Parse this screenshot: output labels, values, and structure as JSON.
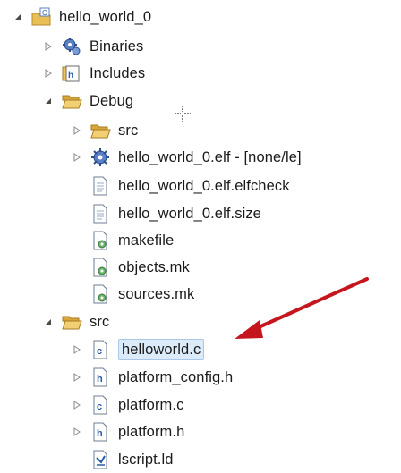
{
  "tree": {
    "items": [
      {
        "label": "hello_world_0",
        "icon": "c-project-icon",
        "twisty": "expanded"
      },
      {
        "label": "Binaries",
        "icon": "binaries-icon",
        "twisty": "collapsed"
      },
      {
        "label": "Includes",
        "icon": "includes-icon",
        "twisty": "collapsed"
      },
      {
        "label": "Debug",
        "icon": "folder-open-icon",
        "twisty": "expanded"
      },
      {
        "label": "src",
        "icon": "folder-open-icon",
        "twisty": "collapsed"
      },
      {
        "label": "hello_world_0.elf - [none/le]",
        "icon": "elf-binary-icon",
        "twisty": "collapsed"
      },
      {
        "label": "hello_world_0.elf.elfcheck",
        "icon": "text-file-icon",
        "twisty": "none"
      },
      {
        "label": "hello_world_0.elf.size",
        "icon": "text-file-icon",
        "twisty": "none"
      },
      {
        "label": "makefile",
        "icon": "makefile-icon",
        "twisty": "none"
      },
      {
        "label": "objects.mk",
        "icon": "makefile-icon",
        "twisty": "none"
      },
      {
        "label": "sources.mk",
        "icon": "makefile-icon",
        "twisty": "none"
      },
      {
        "label": "src",
        "icon": "folder-open-icon",
        "twisty": "expanded"
      },
      {
        "label": "helloworld.c",
        "icon": "c-source-file-icon",
        "twisty": "collapsed",
        "selected": true
      },
      {
        "label": "platform_config.h",
        "icon": "header-file-icon",
        "twisty": "collapsed"
      },
      {
        "label": "platform.c",
        "icon": "c-source-file-icon",
        "twisty": "collapsed"
      },
      {
        "label": "platform.h",
        "icon": "header-file-icon",
        "twisty": "collapsed"
      },
      {
        "label": "lscript.ld",
        "icon": "linker-script-icon",
        "twisty": "none"
      }
    ]
  },
  "colors": {
    "arrow": "#c4161c",
    "selection_bg": "#dcebfa",
    "selection_border": "#a9c7e6",
    "folder": "#e7b94a"
  }
}
